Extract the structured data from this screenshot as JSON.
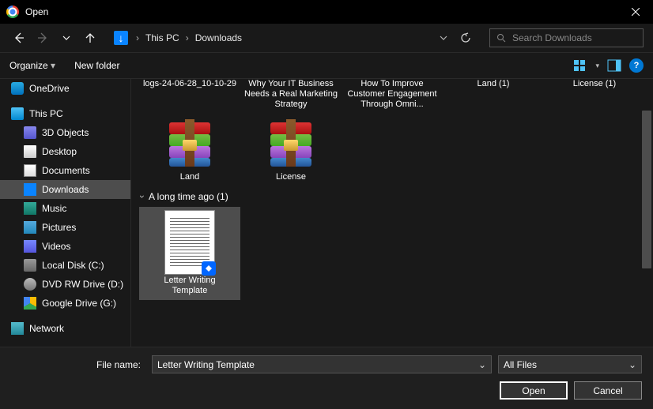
{
  "title": "Open",
  "breadcrumb": {
    "root": "This PC",
    "current": "Downloads"
  },
  "search": {
    "placeholder": "Search Downloads"
  },
  "toolbar": {
    "organize": "Organize",
    "newfolder": "New folder"
  },
  "tree": {
    "onedrive": "OneDrive",
    "thispc": "This PC",
    "obj3d": "3D Objects",
    "desktop": "Desktop",
    "documents": "Documents",
    "downloads": "Downloads",
    "music": "Music",
    "pictures": "Pictures",
    "videos": "Videos",
    "localdisk": "Local Disk (C:)",
    "dvd": "DVD RW Drive (D:)",
    "gdrive": "Google Drive (G:)",
    "network": "Network"
  },
  "toprow": {
    "i0": "logs-24-06-28_10-10-29",
    "i1": "Why Your IT Business Needs a Real Marketing Strategy",
    "i2": "How To Improve Customer Engagement Through Omni...",
    "i3": "Land (1)",
    "i4": "License (1)"
  },
  "rar": {
    "land": "Land",
    "license": "License"
  },
  "group": {
    "label": "A long time ago (1)"
  },
  "doc": {
    "label": "Letter Writing Template"
  },
  "bottom": {
    "fnlabel": "File name:",
    "fnvalue": "Letter Writing Template",
    "filter": "All Files",
    "open": "Open",
    "cancel": "Cancel"
  }
}
